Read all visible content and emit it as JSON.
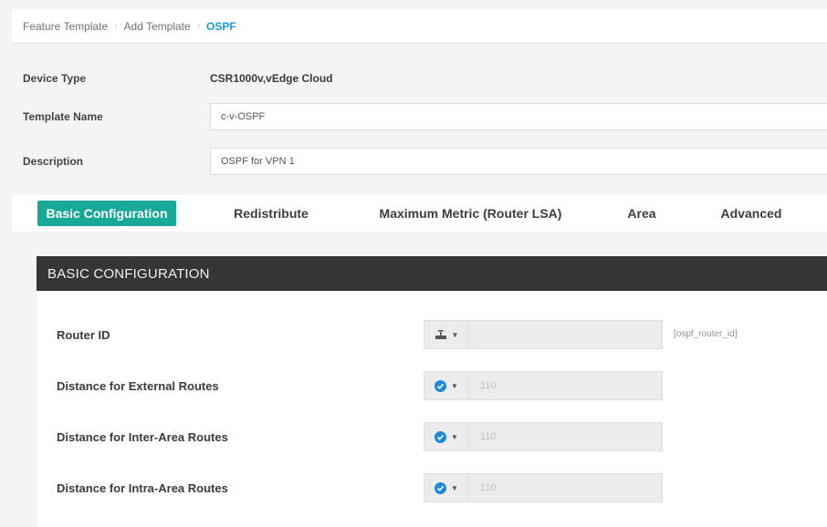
{
  "breadcrumb": {
    "items": [
      "Feature Template",
      "Add Template"
    ],
    "current": "OSPF",
    "separator": "›"
  },
  "form": {
    "device_type_label": "Device Type",
    "device_type_value": "CSR1000v,vEdge Cloud",
    "template_name_label": "Template Name",
    "template_name_value": "c-v-OSPF",
    "description_label": "Description",
    "description_value": "OSPF for VPN 1"
  },
  "tabs": [
    {
      "label": "Basic Configuration",
      "active": true
    },
    {
      "label": "Redistribute",
      "active": false
    },
    {
      "label": "Maximum Metric (Router LSA)",
      "active": false
    },
    {
      "label": "Area",
      "active": false
    },
    {
      "label": "Advanced",
      "active": false
    }
  ],
  "section": {
    "title": "BASIC CONFIGURATION",
    "rows": [
      {
        "label": "Router ID",
        "scope_icon": "device-specific-icon",
        "value": "",
        "variable": "[ospf_router_id]"
      },
      {
        "label": "Distance for External Routes",
        "scope_icon": "default-check-icon",
        "value": "110",
        "variable": ""
      },
      {
        "label": "Distance for Inter-Area Routes",
        "scope_icon": "default-check-icon",
        "value": "110",
        "variable": ""
      },
      {
        "label": "Distance for Intra-Area Routes",
        "scope_icon": "default-check-icon",
        "value": "110",
        "variable": ""
      }
    ]
  },
  "colors": {
    "accent_teal": "#17a898",
    "link_blue": "#1a9fd6",
    "header_dark": "#353535",
    "check_blue": "#1f8bd8"
  }
}
